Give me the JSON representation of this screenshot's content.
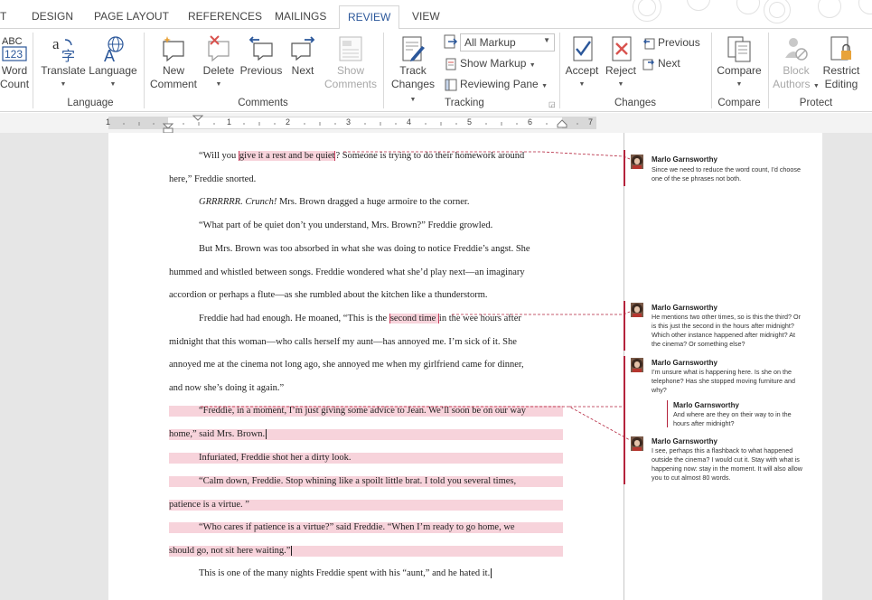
{
  "tabs": [
    "T",
    "DESIGN",
    "PAGE LAYOUT",
    "REFERENCES",
    "MAILINGS",
    "REVIEW",
    "VIEW"
  ],
  "active_tab": "REVIEW",
  "ribbon": {
    "proofing": {
      "word_count": [
        "Word",
        "Count"
      ]
    },
    "language": {
      "translate": "Translate",
      "language": "Language",
      "group_label": "Language"
    },
    "comments": {
      "new_comment": [
        "New",
        "Comment"
      ],
      "delete": "Delete",
      "previous": "Previous",
      "next": "Next",
      "show_comments": [
        "Show",
        "Comments"
      ],
      "group_label": "Comments"
    },
    "tracking": {
      "track_changes": [
        "Track",
        "Changes"
      ],
      "markup_select": "All Markup",
      "show_markup": "Show Markup",
      "reviewing_pane": "Reviewing Pane",
      "group_label": "Tracking"
    },
    "changes": {
      "accept": "Accept",
      "reject": "Reject",
      "previous": "Previous",
      "next": "Next",
      "group_label": "Changes"
    },
    "compare": {
      "compare": "Compare",
      "group_label": "Compare"
    },
    "protect": {
      "block_authors": [
        "Block",
        "Authors"
      ],
      "restrict_editing": [
        "Restrict",
        "Editing"
      ],
      "group_label": "Protect"
    }
  },
  "ruler": {
    "marks": [
      "1",
      "1",
      "2",
      "3",
      "4",
      "5",
      "6",
      "7"
    ]
  },
  "document": {
    "lines": [
      {
        "pre": "“Will you ",
        "hl": "give it a rest and be quiet",
        "post": "? Someone is trying to do their homework around"
      },
      {
        "text": "here,” Freddie snorted."
      },
      {
        "ital": "GRRRRRR. Crunch!",
        "post": " Mrs. Brown dragged a huge armoire to the corner."
      },
      {
        "text": "“What part of be quiet don’t you understand, Mrs. Brown?” Freddie growled."
      },
      {
        "text": "But Mrs. Brown was too absorbed in what she was doing to notice Freddie’s angst. She"
      },
      {
        "text": "hummed and whistled between songs. Freddie wondered what she’d play next—an imaginary"
      },
      {
        "text": "accordion or perhaps a flute—as she rumbled about the kitchen like a thunderstorm."
      },
      {
        "pre": "Freddie had had enough. He moaned, “This is the ",
        "hl": "second time ",
        "post": "in the wee hours after"
      },
      {
        "text": "midnight that this woman—who calls herself my aunt—has annoyed me. I’m sick of it. She"
      },
      {
        "text": "annoyed me at the cinema not long ago, she annoyed me when my girlfriend came for dinner,"
      },
      {
        "text": "and now she’s doing it again.”"
      },
      {
        "text": "“Freddie, in a moment, I’m just giving some advice to Jean. We’ll soon be on our way"
      },
      {
        "text": "home,” said Mrs. Brown."
      },
      {
        "text": "Infuriated, Freddie shot her a dirty look."
      },
      {
        "text": "“Calm down, Freddie. Stop whining like a spoilt little brat. I told you several times,"
      },
      {
        "text": "patience is a virtue. ”"
      },
      {
        "text": "“Who cares if patience is a virtue?” said Freddie. “When I’m ready to go home, we"
      },
      {
        "text": "should go, not sit here waiting.”"
      },
      {
        "text": "This is one of the many nights Freddie spent with his “aunt,” and he hated it."
      }
    ]
  },
  "comments": [
    {
      "author": "Marlo Garnsworthy",
      "lines": [
        "Since we need to reduce the word count, I’d choose",
        "one of the se phrases not both."
      ]
    },
    {
      "author": "Marlo Garnsworthy",
      "lines": [
        "He mentions two other times, so is this the third? Or",
        "is this just the second in the hours after midnight?",
        "Which other instance happened after midnight? At",
        "the cinema? Or something else?"
      ]
    },
    {
      "author": "Marlo Garnsworthy",
      "lines": [
        "I’m unsure what is happening here. Is she on the",
        "telephone? Has she stopped moving furniture and",
        "why?"
      ]
    },
    {
      "author": "Marlo Garnsworthy",
      "lines": [
        "And where are they on their way to in the",
        "hours after midnight?"
      ]
    },
    {
      "author": "Marlo Garnsworthy",
      "lines": [
        "I see, perhaps this a flashback to what happened",
        "outside the cinema? I would cut it. Stay with what is",
        "happening now: stay in the moment. It will also allow",
        "you to cut almost 80 words."
      ]
    }
  ],
  "colors": {
    "accent": "#2b579a",
    "comment": "#b4233c",
    "highlight": "#f7d3db"
  }
}
